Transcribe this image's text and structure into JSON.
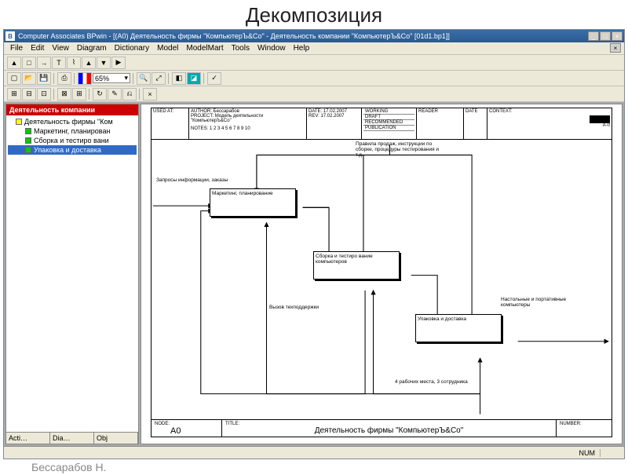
{
  "slide_title": "Декомпозиция",
  "window": {
    "title": "Computer Associates BPwin - [(A0) Деятельность фирмы \"КомпьютерЪ&Co\" - Деятельность компании \"КомпьютерЪ&Co\" [01d1.bp1]]",
    "icon_letter": "B"
  },
  "menu": [
    "File",
    "Edit",
    "View",
    "Diagram",
    "Dictionary",
    "Model",
    "ModelMart",
    "Tools",
    "Window",
    "Help"
  ],
  "zoom": "65%",
  "sidebar": {
    "title": "Деятельность компании",
    "items": [
      {
        "color": "y",
        "label": "Деятельность фирмы \"Ком"
      },
      {
        "color": "g",
        "label": "Маркетинг, планирован"
      },
      {
        "color": "g",
        "label": "Сборка и тестиро вани"
      },
      {
        "color": "g",
        "label": "Упаковка и доставка",
        "selected": true
      }
    ],
    "tabs": [
      "Acti…",
      "Dia…",
      "Obj"
    ]
  },
  "header": {
    "used_at": "USED AT:",
    "author_label": "AUTHOR:",
    "author": "Бессарабов",
    "project_label": "PROJECT:",
    "project": "Модель деятельности \"КомпьютерЪ&Co\"",
    "notes": "NOTES: 1 2 3 4 5 6 7 8 9 10",
    "date_label": "DATE:",
    "date": "17.02.2007",
    "rev_label": "REV:",
    "rev": "17.02.2007",
    "status": [
      "WORKING",
      "DRAFT",
      "RECOMMENDED",
      "PUBLICATION"
    ],
    "reader": "READER",
    "date2": "DATE",
    "context": "CONTEXT:",
    "node_ctx": "A-0"
  },
  "activities": {
    "a1": "Маркетинг, планирование",
    "a2": "Сборка и тестиро вание компьютеров",
    "a3": "Упаковка и доставка"
  },
  "arrows": {
    "top": "Правила продаж, инструкции по сборке, процедуры тестирования и т.д.",
    "left": "Запросы информации, заказы",
    "bottom1": "Вызов техподдержки",
    "bottom2": "4 рабочих места, 3 сотрудника",
    "right": "Настольные и портативные компьютеры"
  },
  "footer": {
    "node_label": "NODE:",
    "node": "A0",
    "title_label": "TITLE:",
    "title": "Деятельность фирмы \"КомпьютерЪ&Co\"",
    "number_label": "NUMBER:"
  },
  "statusbar": {
    "num": "NUM"
  },
  "caption": "Бессарабов Н."
}
